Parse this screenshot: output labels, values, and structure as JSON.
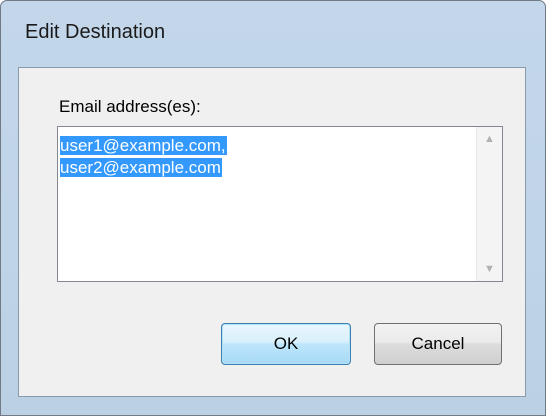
{
  "window": {
    "title": "Edit Destination"
  },
  "form": {
    "email_label": "Email address(es):",
    "email_lines": [
      "user1@example.com,",
      "user2@example.com"
    ]
  },
  "buttons": {
    "ok_label": "OK",
    "cancel_label": "Cancel"
  },
  "colors": {
    "selection": "#3399ff",
    "frame": "#c3d6ea",
    "client": "#f0f0f0",
    "default_button": "#bee6fd"
  },
  "icons": {
    "scroll_up": "scroll-up-arrow-icon",
    "scroll_down": "scroll-down-arrow-icon"
  }
}
